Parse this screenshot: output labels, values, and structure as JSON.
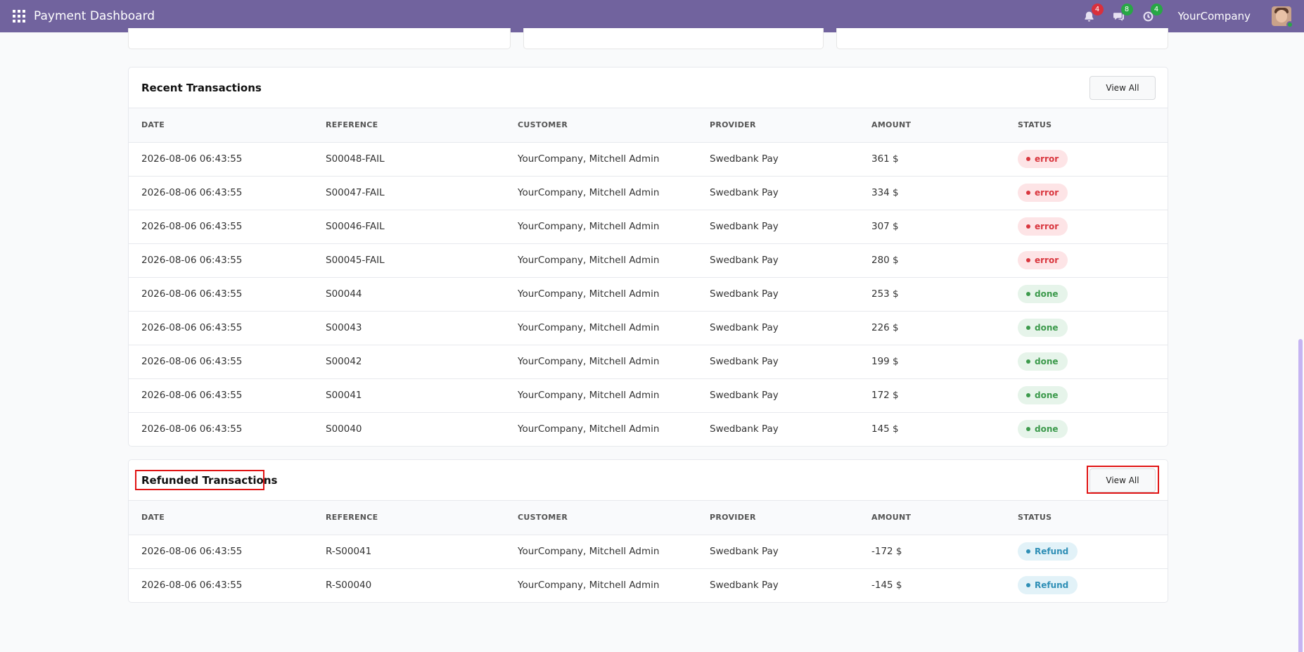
{
  "navbar": {
    "title": "Payment Dashboard",
    "company": "YourCompany",
    "activity_badge": "4",
    "messages_badge": "8",
    "clock_badge": "4"
  },
  "recent": {
    "title": "Recent Transactions",
    "view_all": "View All",
    "columns": [
      "DATE",
      "REFERENCE",
      "CUSTOMER",
      "PROVIDER",
      "AMOUNT",
      "STATUS"
    ],
    "rows": [
      {
        "date": "2026-08-06 06:43:55",
        "reference": "S00048-FAIL",
        "customer": "YourCompany, Mitchell Admin",
        "provider": "Swedbank Pay",
        "amount": "361 $",
        "status": "error"
      },
      {
        "date": "2026-08-06 06:43:55",
        "reference": "S00047-FAIL",
        "customer": "YourCompany, Mitchell Admin",
        "provider": "Swedbank Pay",
        "amount": "334 $",
        "status": "error"
      },
      {
        "date": "2026-08-06 06:43:55",
        "reference": "S00046-FAIL",
        "customer": "YourCompany, Mitchell Admin",
        "provider": "Swedbank Pay",
        "amount": "307 $",
        "status": "error"
      },
      {
        "date": "2026-08-06 06:43:55",
        "reference": "S00045-FAIL",
        "customer": "YourCompany, Mitchell Admin",
        "provider": "Swedbank Pay",
        "amount": "280 $",
        "status": "error"
      },
      {
        "date": "2026-08-06 06:43:55",
        "reference": "S00044",
        "customer": "YourCompany, Mitchell Admin",
        "provider": "Swedbank Pay",
        "amount": "253 $",
        "status": "done"
      },
      {
        "date": "2026-08-06 06:43:55",
        "reference": "S00043",
        "customer": "YourCompany, Mitchell Admin",
        "provider": "Swedbank Pay",
        "amount": "226 $",
        "status": "done"
      },
      {
        "date": "2026-08-06 06:43:55",
        "reference": "S00042",
        "customer": "YourCompany, Mitchell Admin",
        "provider": "Swedbank Pay",
        "amount": "199 $",
        "status": "done"
      },
      {
        "date": "2026-08-06 06:43:55",
        "reference": "S00041",
        "customer": "YourCompany, Mitchell Admin",
        "provider": "Swedbank Pay",
        "amount": "172 $",
        "status": "done"
      },
      {
        "date": "2026-08-06 06:43:55",
        "reference": "S00040",
        "customer": "YourCompany, Mitchell Admin",
        "provider": "Swedbank Pay",
        "amount": "145 $",
        "status": "done"
      }
    ]
  },
  "refunded": {
    "title": "Refunded Transactions",
    "view_all": "View All",
    "columns": [
      "DATE",
      "REFERENCE",
      "CUSTOMER",
      "PROVIDER",
      "AMOUNT",
      "STATUS"
    ],
    "rows": [
      {
        "date": "2026-08-06 06:43:55",
        "reference": "R-S00041",
        "customer": "YourCompany, Mitchell Admin",
        "provider": "Swedbank Pay",
        "amount": "-172 $",
        "status": "Refund"
      },
      {
        "date": "2026-08-06 06:43:55",
        "reference": "R-S00040",
        "customer": "YourCompany, Mitchell Admin",
        "provider": "Swedbank Pay",
        "amount": "-145 $",
        "status": "Refund"
      }
    ]
  }
}
